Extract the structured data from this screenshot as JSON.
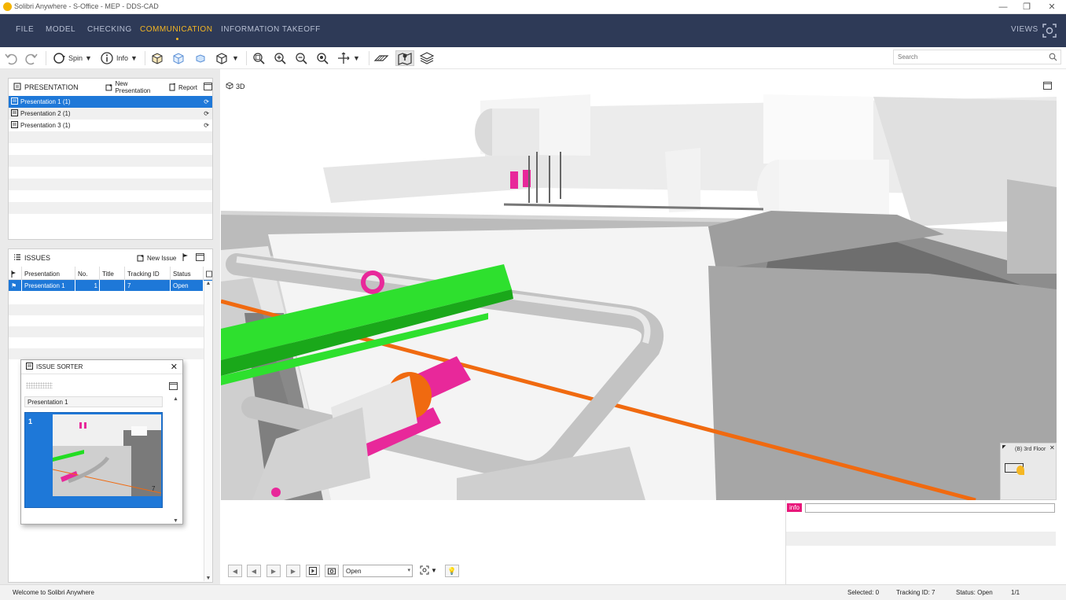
{
  "window": {
    "title": "Solibri Anywhere - S-Office - MEP - DDS-CAD",
    "minimize": "—",
    "maximize": "❐",
    "close": "✕"
  },
  "menu": {
    "items": [
      {
        "label": "FILE"
      },
      {
        "label": "MODEL"
      },
      {
        "label": "CHECKING"
      },
      {
        "label": "COMMUNICATION"
      },
      {
        "label": "INFORMATION TAKEOFF"
      }
    ],
    "views_label": "VIEWS",
    "active_color": "#f5b723"
  },
  "toolbar": {
    "spin_label": "Spin",
    "info_label": "Info",
    "search_placeholder": "Search"
  },
  "presentation": {
    "header": "PRESENTATION",
    "new_label": "New Presentation",
    "report_label": "Report",
    "items": [
      {
        "label": "Presentation 1 (1)"
      },
      {
        "label": "Presentation 2 (1)"
      },
      {
        "label": "Presentation 3 (1)"
      }
    ]
  },
  "issues": {
    "header": "ISSUES",
    "new_label": "New Issue",
    "columns": [
      "Presentation",
      "No.",
      "Title",
      "Tracking ID",
      "Status"
    ],
    "rows": [
      {
        "presentation": "Presentation 1",
        "no": "1",
        "title": "",
        "tracking_id": "7",
        "status": "Open"
      }
    ]
  },
  "issue_sorter": {
    "header": "ISSUE SORTER",
    "group_label": "Presentation 1",
    "slide_number": "1",
    "thumb_number": "7"
  },
  "viewport": {
    "label": "3D",
    "floor_label": "(B) 3rd Floor"
  },
  "bottom": {
    "status_select": "Open",
    "info_tag": "info",
    "info_tag_color": "#e8177a"
  },
  "status": {
    "welcome": "Welcome to Solibri Anywhere",
    "selected": "Selected: 0",
    "tracking": "Tracking ID: 7",
    "status": "Status: Open",
    "page": "1/1"
  },
  "colors": {
    "menu_bg": "#2e3a57",
    "selection": "#1e78d8",
    "green_beam": "#2ee02e",
    "magenta": "#e8289a",
    "orange": "#f06a10"
  }
}
